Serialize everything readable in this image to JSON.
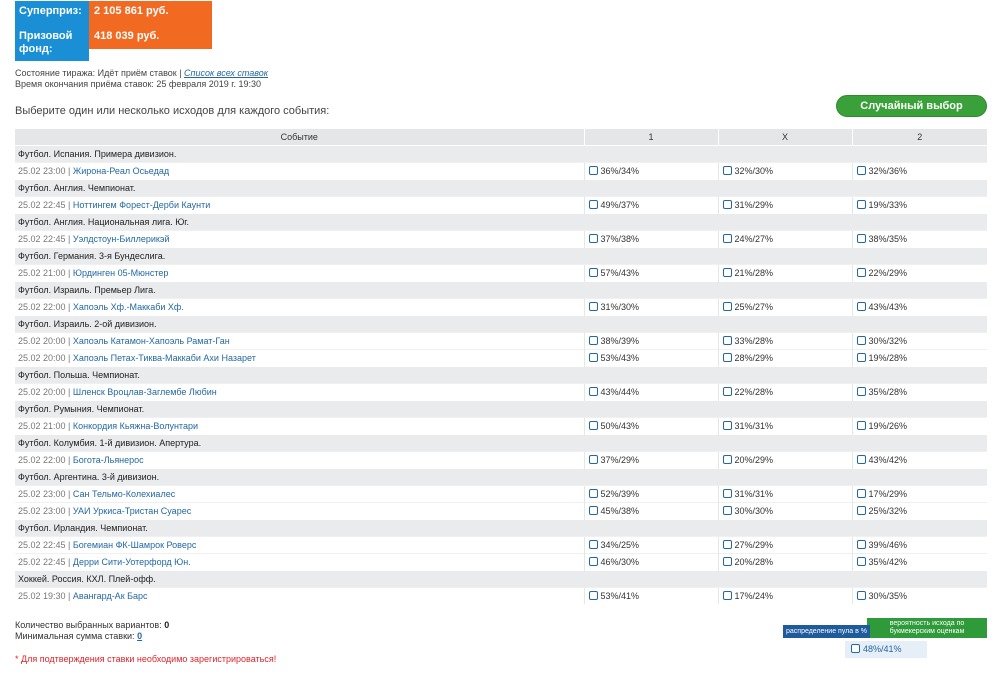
{
  "prize": {
    "superprize_label": "Суперприз:",
    "superprize_value": "2 105 861 руб.",
    "fund_label": "Призовой фонд:",
    "fund_value": "418 039 руб."
  },
  "status": {
    "state_text": "Состояние тиража: Идёт приём ставок |",
    "all_bets_link": "Список всех ставок",
    "end_time_text": "Время окончания приёма ставок: 25 февраля 2019 г. 19:30"
  },
  "choose_text": "Выберите один или несколько исходов для каждого события:",
  "random_button": "Случайный выбор",
  "table": {
    "headers": [
      "Событие",
      "1",
      "X",
      "2"
    ],
    "groups": [
      {
        "title": "Футбол. Испания. Примера дивизион.",
        "matches": [
          {
            "time": "25.02 23:00",
            "name": "Жирона-Реал Осьедад",
            "o1": "36%/34%",
            "ox": "32%/30%",
            "o2": "32%/36%"
          }
        ]
      },
      {
        "title": "Футбол. Англия. Чемпионат.",
        "matches": [
          {
            "time": "25.02 22:45",
            "name": "Ноттингем Форест-Дерби Каунти",
            "o1": "49%/37%",
            "ox": "31%/29%",
            "o2": "19%/33%"
          }
        ]
      },
      {
        "title": "Футбол. Англия. Национальная лига. Юг.",
        "matches": [
          {
            "time": "25.02 22:45",
            "name": "Уэлдстоун-Биллерикэй",
            "o1": "37%/38%",
            "ox": "24%/27%",
            "o2": "38%/35%"
          }
        ]
      },
      {
        "title": "Футбол. Германия. 3-я Бундеслига.",
        "matches": [
          {
            "time": "25.02 21:00",
            "name": "Юрдинген 05-Мюнстер",
            "o1": "57%/43%",
            "ox": "21%/28%",
            "o2": "22%/29%"
          }
        ]
      },
      {
        "title": "Футбол. Израиль. Премьер Лига.",
        "matches": [
          {
            "time": "25.02 22:00",
            "name": "Хапоэль Хф.-Маккаби Хф.",
            "o1": "31%/30%",
            "ox": "25%/27%",
            "o2": "43%/43%"
          }
        ]
      },
      {
        "title": "Футбол. Израиль. 2-ой дивизион.",
        "matches": [
          {
            "time": "25.02 20:00",
            "name": "Хапоэль Катамон-Хапоэль Рамат-Ган",
            "o1": "38%/39%",
            "ox": "33%/28%",
            "o2": "30%/32%"
          },
          {
            "time": "25.02 20:00",
            "name": "Хапоэль Петах-Тиква-Маккаби Ахи Назарет",
            "o1": "53%/43%",
            "ox": "28%/29%",
            "o2": "19%/28%"
          }
        ]
      },
      {
        "title": "Футбол. Польша. Чемпионат.",
        "matches": [
          {
            "time": "25.02 20:00",
            "name": "Шленск Вроцлав-Заглембе Любин",
            "o1": "43%/44%",
            "ox": "22%/28%",
            "o2": "35%/28%"
          }
        ]
      },
      {
        "title": "Футбол. Румыния. Чемпионат.",
        "matches": [
          {
            "time": "25.02 21:00",
            "name": "Конкордия Кьяжна-Волунтари",
            "o1": "50%/43%",
            "ox": "31%/31%",
            "o2": "19%/26%"
          }
        ]
      },
      {
        "title": "Футбол. Колумбия. 1-й дивизион. Апертура.",
        "matches": [
          {
            "time": "25.02 22:00",
            "name": "Богота-Льянерос",
            "o1": "37%/29%",
            "ox": "20%/29%",
            "o2": "43%/42%"
          }
        ]
      },
      {
        "title": "Футбол. Аргентина. 3-й дивизион.",
        "matches": [
          {
            "time": "25.02 23:00",
            "name": "Сан Тельмо-Колехиалес",
            "o1": "52%/39%",
            "ox": "31%/31%",
            "o2": "17%/29%"
          },
          {
            "time": "25.02 23:00",
            "name": "УАИ Уркиса-Тристан Суарес",
            "o1": "45%/38%",
            "ox": "30%/30%",
            "o2": "25%/32%"
          }
        ]
      },
      {
        "title": "Футбол. Ирландия. Чемпионат.",
        "matches": [
          {
            "time": "25.02 22:45",
            "name": "Богемиан ФК-Шамрок Роверс",
            "o1": "34%/25%",
            "ox": "27%/29%",
            "o2": "39%/46%"
          },
          {
            "time": "25.02 22:45",
            "name": "Дерри Сити-Уотерфорд Юн.",
            "o1": "46%/30%",
            "ox": "20%/28%",
            "o2": "35%/42%"
          }
        ]
      },
      {
        "title": "Хоккей. Россия. КХЛ. Плей-офф.",
        "matches": [
          {
            "time": "25.02 19:30",
            "name": "Авангард-Ак Барс",
            "o1": "53%/41%",
            "ox": "17%/24%",
            "o2": "30%/35%"
          }
        ]
      }
    ]
  },
  "footer": {
    "selected_label": "Количество выбранных вариантов:",
    "selected_value": "0",
    "min_label": "Минимальная сумма ставки:",
    "min_value": "0",
    "reg_note": "* Для подтверждения ставки необходимо зарегистрироваться!"
  },
  "legend": {
    "pool_label": "распределение пула в %",
    "bookmaker_label": "вероятность исхода по букмекерским оценкам",
    "sample_value": "48%/41%"
  },
  "colors": {
    "accent_blue": "#1a8fd6",
    "accent_orange": "#f26a22",
    "button_green": "#3aa03a",
    "link": "#2468a2",
    "error_red": "#e0232b"
  }
}
